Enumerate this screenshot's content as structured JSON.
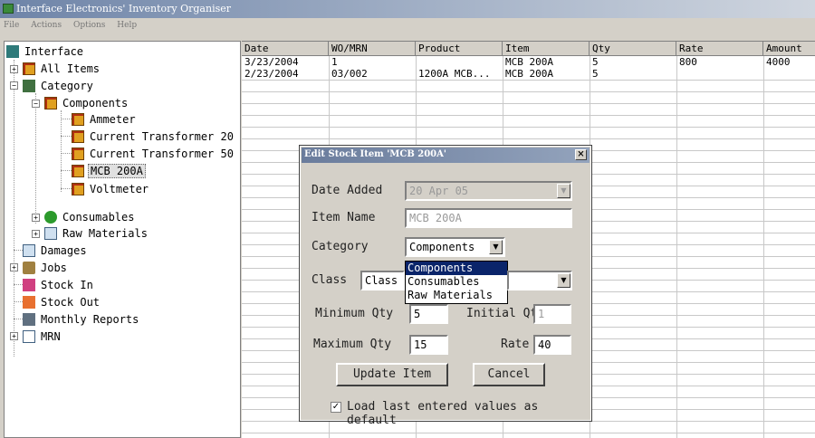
{
  "window": {
    "title": "Interface Electronics' Inventory Organiser"
  },
  "menu": [
    "File",
    "Actions",
    "Options",
    "Help"
  ],
  "tree": {
    "items": [
      {
        "label": "Interface",
        "icon": "tree-root-icon"
      },
      {
        "label": "All Items",
        "icon": "items-icon"
      },
      {
        "label": "Category",
        "icon": "category-icon"
      },
      {
        "label": "Components",
        "icon": "folder-icon"
      },
      {
        "label": "Ammeter",
        "icon": "box-icon"
      },
      {
        "label": "Current Transformer 20",
        "icon": "box-icon"
      },
      {
        "label": "Current Transformer 50",
        "icon": "box-icon"
      },
      {
        "label": "MCB 200A",
        "icon": "box-icon"
      },
      {
        "label": "Voltmeter",
        "icon": "box-icon"
      },
      {
        "label": "Consumables",
        "icon": "consumables-icon"
      },
      {
        "label": "Raw Materials",
        "icon": "raw-materials-icon"
      },
      {
        "label": "Damages",
        "icon": "damages-icon"
      },
      {
        "label": "Jobs",
        "icon": "jobs-icon"
      },
      {
        "label": "Stock In",
        "icon": "stock-in-icon"
      },
      {
        "label": "Stock Out",
        "icon": "stock-out-icon"
      },
      {
        "label": "Monthly Reports",
        "icon": "reports-icon"
      },
      {
        "label": "MRN",
        "icon": "mrn-icon"
      }
    ]
  },
  "grid": {
    "columns": [
      "Date",
      "WO/MRN",
      "Product",
      "Item",
      "Qty",
      "Rate",
      "Amount"
    ],
    "rows": [
      [
        "3/23/2004",
        "1",
        "",
        "MCB 200A",
        "5",
        "800",
        "4000"
      ],
      [
        "2/23/2004",
        "03/002",
        "1200A MCB...",
        "MCB 200A",
        "5",
        "",
        ""
      ]
    ]
  },
  "dialog": {
    "title": "Edit Stock Item 'MCB 200A'",
    "date_added_label": "Date Added",
    "date_added_value": "20 Apr 05",
    "item_name_label": "Item Name",
    "item_name_value": "MCB 200A",
    "category_label": "Category",
    "category_value": "Components",
    "category_options": [
      "Components",
      "Consumables",
      "Raw Materials"
    ],
    "class_label": "Class",
    "class_value": "Class A",
    "min_qty_label": "Minimum Qty",
    "min_qty_value": "5",
    "initial_qty_label": "Initial Qty",
    "initial_qty_value": "1",
    "max_qty_label": "Maximum Qty",
    "max_qty_value": "15",
    "rate_label": "Rate",
    "rate_value": "40",
    "update_button": "Update Item",
    "cancel_button": "Cancel",
    "checkbox_label": "Load last entered values as default",
    "checkbox_checked": true
  },
  "colors": {
    "selection": "#0a246a",
    "titlebar": "#6e84a8"
  }
}
